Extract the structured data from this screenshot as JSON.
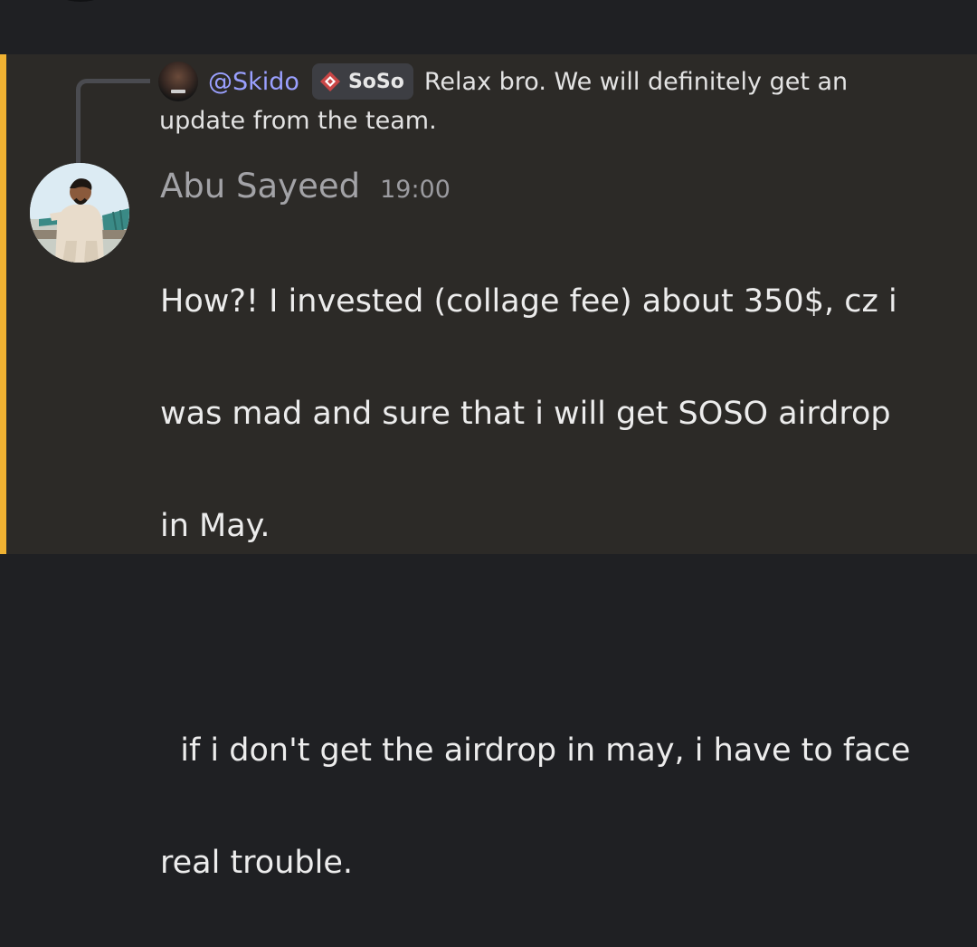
{
  "reply": {
    "author": "@Skido",
    "role": "SoSo",
    "text_line1": "Relax bro.  We will definitely get an",
    "text_line2": "update from the team."
  },
  "message": {
    "author": "Abu Sayeed",
    "timestamp": "19:00",
    "lines": [
      "How?! I invested (collage fee) about 350$, cz i",
      "was mad and sure that i will get SOSO airdrop",
      "in May.",
      "",
      "  if i don't get the airdrop in may, i have to face",
      "real trouble."
    ]
  },
  "colors": {
    "highlight_bar": "#f0b232",
    "mention": "#9aa0ff",
    "panel_bg": "#2c2a27"
  },
  "icons": {
    "role_icon": "soso-diamond-icon",
    "reply_spine": "reply-connector"
  }
}
